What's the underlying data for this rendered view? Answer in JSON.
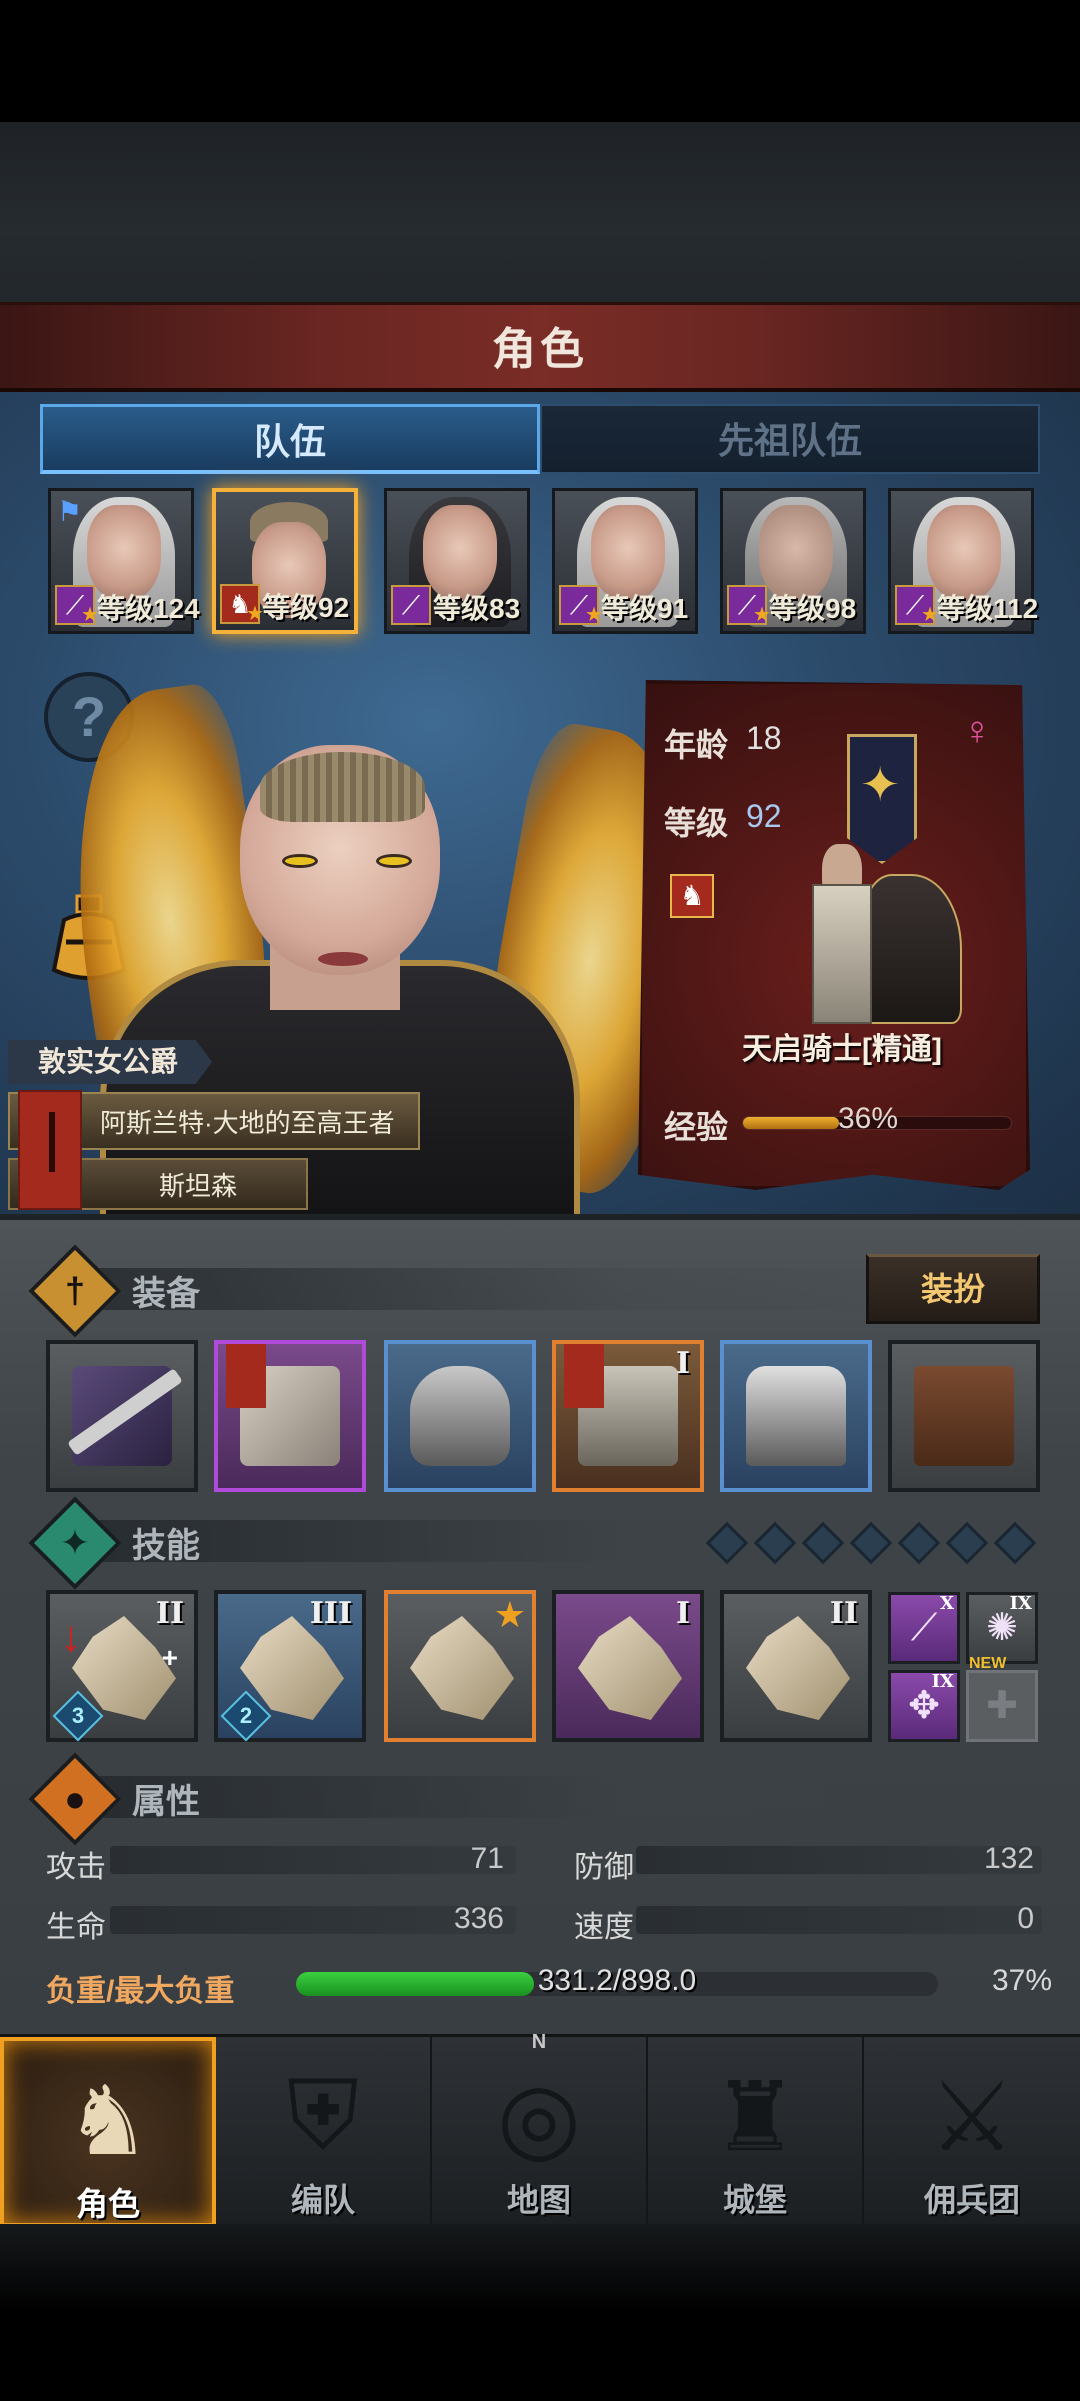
{
  "screen_title": "角色",
  "tabs": [
    {
      "label": "队伍",
      "active": true
    },
    {
      "label": "先祖队伍",
      "active": false
    }
  ],
  "heroes": [
    {
      "level_text": "等级124",
      "class_icon": "staff-icon",
      "selected": false
    },
    {
      "level_text": "等级92",
      "class_icon": "knight-icon",
      "selected": true
    },
    {
      "level_text": "等级83",
      "class_icon": "staff-icon",
      "selected": false
    },
    {
      "level_text": "等级91",
      "class_icon": "staff-icon",
      "selected": false
    },
    {
      "level_text": "等级98",
      "class_icon": "staff-icon",
      "selected": false
    },
    {
      "level_text": "等级112",
      "class_icon": "staff-icon",
      "selected": false
    }
  ],
  "character": {
    "noble_title": "敦实女公爵",
    "epithet": "阿斯兰特·大地的至高王者",
    "name": "斯坦森"
  },
  "info": {
    "age_label": "年龄",
    "age": "18",
    "level_label": "等级",
    "level": "92",
    "class_name": "天启骑士[精通]",
    "exp_label": "经验",
    "exp_pct": "36%",
    "exp_fraction": 0.36,
    "gender_icon": "female-icon"
  },
  "equipment": {
    "title": "装备",
    "dress_button": "装扮",
    "slots": [
      {
        "type": "weapon",
        "rarity": "plain"
      },
      {
        "type": "shield",
        "rarity": "purple"
      },
      {
        "type": "helmet",
        "rarity": "blue"
      },
      {
        "type": "armor",
        "rarity": "orange",
        "rank": "I"
      },
      {
        "type": "boots",
        "rarity": "blue"
      },
      {
        "type": "book",
        "rarity": "plain"
      }
    ]
  },
  "skills": {
    "title": "技能",
    "pip_count": 7,
    "slots": [
      {
        "rank": "II",
        "count": "3"
      },
      {
        "rank": "III",
        "count": "2"
      },
      {
        "rank": "",
        "count": ""
      },
      {
        "rank": "I",
        "count": ""
      },
      {
        "rank": "II",
        "count": ""
      }
    ],
    "minis": [
      {
        "rank": "X",
        "icon": "wand-icon"
      },
      {
        "rank": "IX",
        "icon": "burst-icon"
      },
      {
        "rank": "IX",
        "icon": "cross-star-icon"
      },
      {
        "rank": "",
        "icon": "cross-icon",
        "badge": "NEW"
      }
    ]
  },
  "attributes": {
    "title": "属性",
    "attack_label": "攻击",
    "attack": "71",
    "defense_label": "防御",
    "defense": "132",
    "hp_label": "生命",
    "hp": "336",
    "speed_label": "速度",
    "speed": "0",
    "load_label": "负重/最大负重",
    "load_text": "331.2/898.0",
    "load_pct": "37%",
    "load_fraction": 0.37
  },
  "nav": [
    {
      "label": "角色",
      "active": true
    },
    {
      "label": "编队",
      "active": false
    },
    {
      "label": "地图",
      "active": false
    },
    {
      "label": "城堡",
      "active": false
    },
    {
      "label": "佣兵团",
      "active": false
    }
  ],
  "colors": {
    "accent_gold": "#f4b23a",
    "tab_blue": "#5aa8e8",
    "title_red": "#7a2c26",
    "load_green": "#3ad040"
  }
}
